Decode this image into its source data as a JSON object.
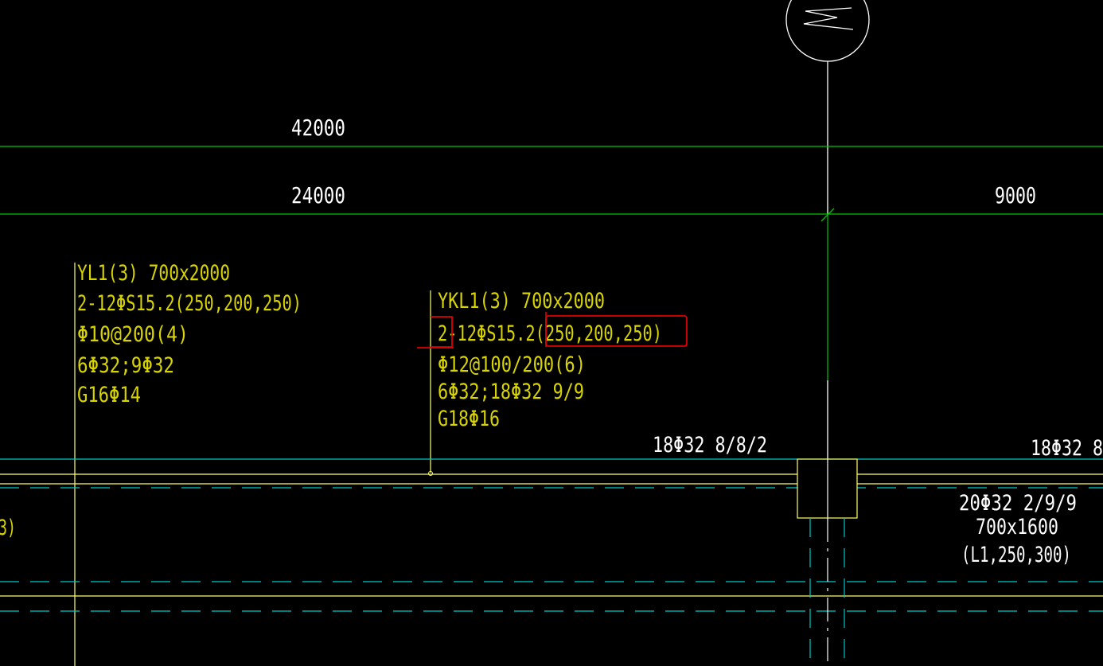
{
  "colors": {
    "background": "#000000",
    "grid_line": "#00c800",
    "dimension_text": "#ffffff",
    "annotation_text": "#d8d400",
    "beam_edge": "#ffff66",
    "hidden_line": "#00c8c8",
    "markup": "#e00000",
    "axis_bubble": "#ffffff"
  },
  "axis_bubble": {
    "label": "M"
  },
  "dimensions": {
    "total": "42000",
    "span_left": "24000",
    "span_right": "9000"
  },
  "beam_YL1": {
    "lines": [
      "YL1(3) 700x2000",
      "2-12ΦS15.2(250,200,250)",
      "Φ10@200(4)",
      "6Φ32;9Φ32",
      "G16Φ14"
    ]
  },
  "beam_YKL1": {
    "lines": [
      "YKL1(3) 700x2000",
      "2-12ΦS15.2(250,200,250)",
      "Φ12@100/200(6)",
      "6Φ32;18Φ32 9/9",
      "G18Φ16"
    ]
  },
  "rebar_notes": {
    "top_mid": "18Φ32 8/8/2",
    "top_right": "18Φ32 8",
    "bottom_right_1": "20Φ32 2/9/9",
    "bottom_right_2": "700x1600",
    "bottom_right_3": "(L1,250,300)",
    "left_edge": "3)"
  }
}
